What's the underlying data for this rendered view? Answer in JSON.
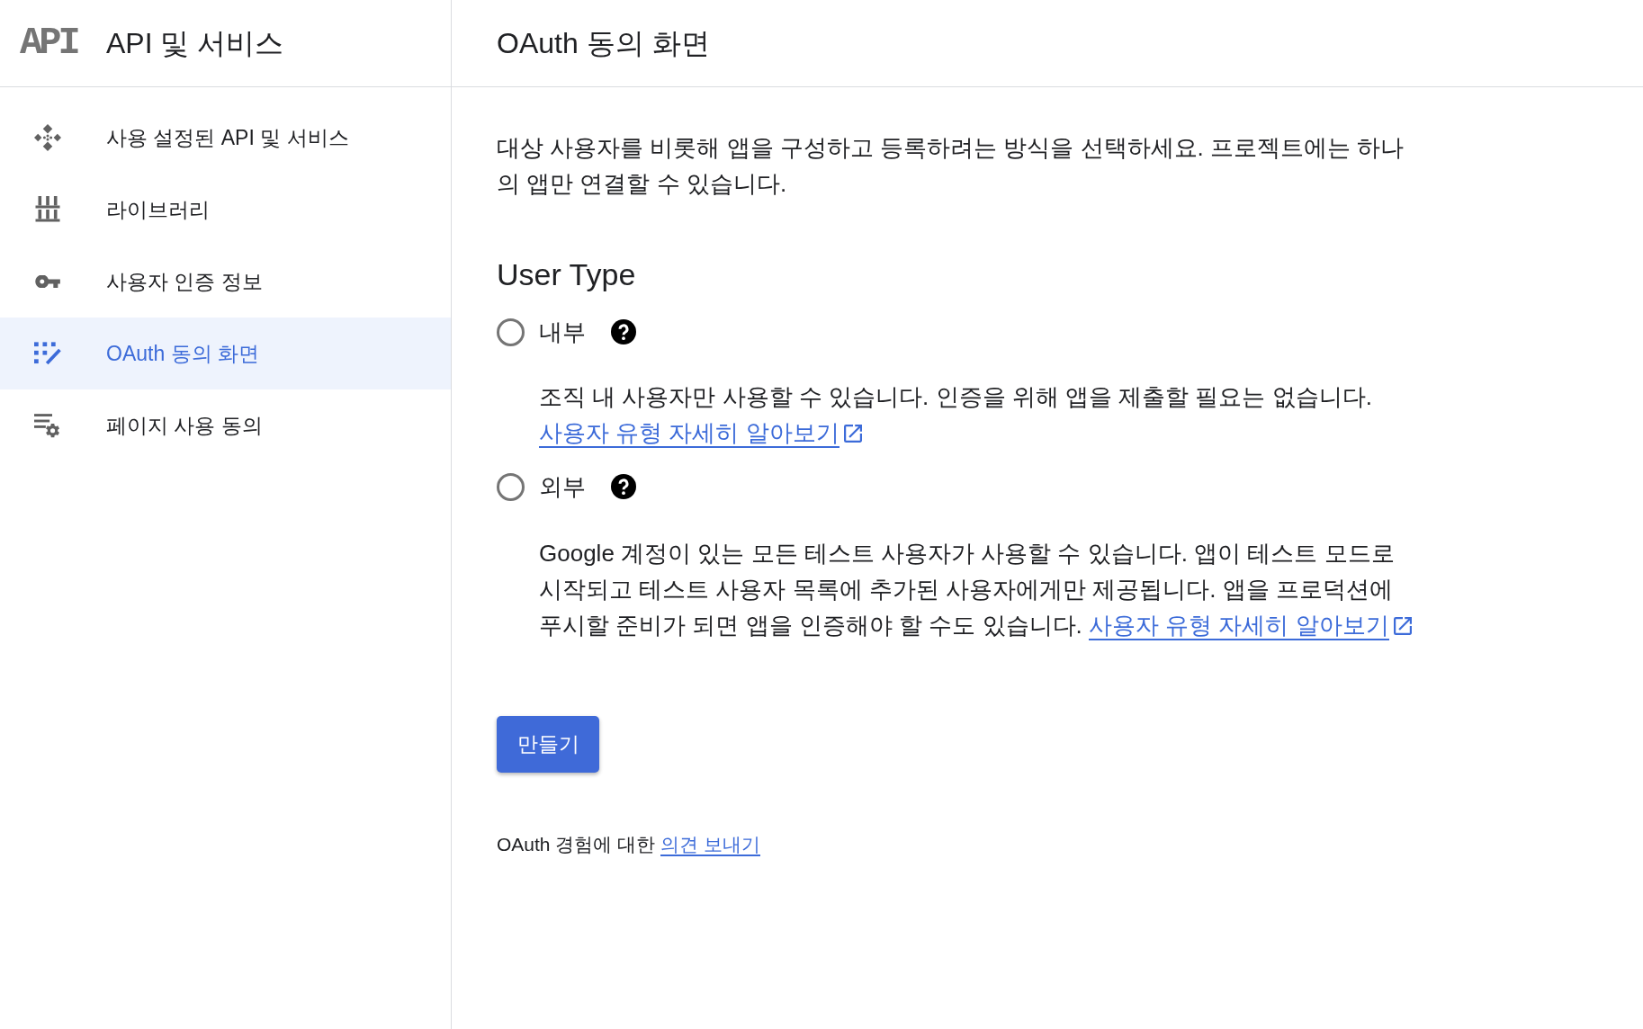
{
  "app": {
    "logo": "API",
    "title": "API 및 서비스"
  },
  "sidebar": {
    "items": [
      {
        "kind": "enabled",
        "label": "사용 설정된 API 및 서비스",
        "selected": false
      },
      {
        "kind": "library",
        "label": "라이브러리",
        "selected": false
      },
      {
        "kind": "credentials",
        "label": "사용자 인증 정보",
        "selected": false
      },
      {
        "kind": "consent",
        "label": "OAuth 동의 화면",
        "selected": true
      },
      {
        "kind": "agreements",
        "label": "페이지 사용 동의",
        "selected": false
      }
    ]
  },
  "page": {
    "title": "OAuth 동의 화면"
  },
  "intro": "대상 사용자를 비롯해 앱을 구성하고 등록하려는 방식을 선택하세요. 프로젝트에는 하나의 앱만 연결할 수 있습니다.",
  "user_type": {
    "heading": "User Type",
    "options": [
      {
        "label": "내부",
        "selected": false,
        "description": "조직 내 사용자만 사용할 수 있습니다. 인증을 위해 앱을 제출할 필요는 없습니다.",
        "link": "사용자 유형 자세히 알아보기"
      },
      {
        "label": "외부",
        "selected": false,
        "description": "Google 계정이 있는 모든 테스트 사용자가 사용할 수 있습니다. 앱이 테스트 모드로 시작되고 테스트 사용자 목록에 추가된 사용자에게만 제공됩니다. 앱을 프로덕션에 푸시할 준비가 되면 앱을 인증해야 할 수도 있습니다.",
        "link": "사용자 유형 자세히 알아보기"
      }
    ]
  },
  "create_button": "만들기",
  "feedback": {
    "text": "OAuth 경험에 대한",
    "link": "의견 보내기"
  }
}
